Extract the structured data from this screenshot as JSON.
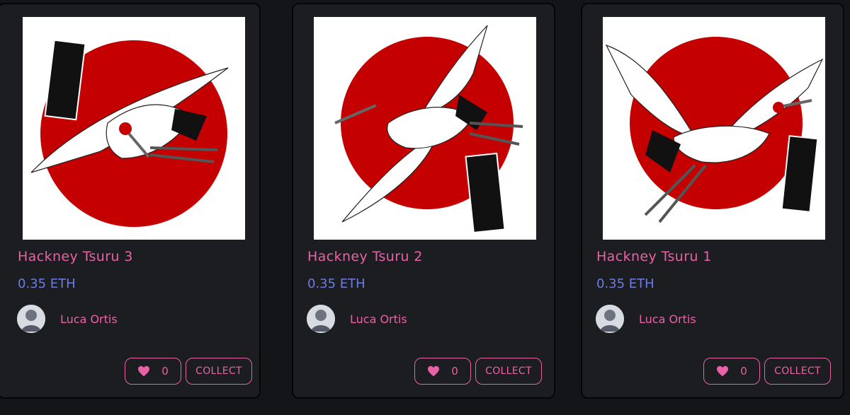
{
  "colors": {
    "background": "#141518",
    "card": "#1b1d21",
    "accent_pink": "#ea62a6",
    "price_blue": "#6d7ce0",
    "sun_red": "#c40000"
  },
  "cards": [
    {
      "title": "Hackney Tsuru 3",
      "price": "0.35 ETH",
      "creator": "Luca Ortis",
      "likes": "0",
      "collect_label": "COLLECT",
      "art_icon": "crane-rising-sun-artwork"
    },
    {
      "title": "Hackney Tsuru 2",
      "price": "0.35 ETH",
      "creator": "Luca Ortis",
      "likes": "0",
      "collect_label": "COLLECT",
      "art_icon": "crane-rising-sun-artwork"
    },
    {
      "title": "Hackney Tsuru 1",
      "price": "0.35 ETH",
      "creator": "Luca Ortis",
      "likes": "0",
      "collect_label": "COLLECT",
      "art_icon": "crane-rising-sun-artwork"
    }
  ]
}
